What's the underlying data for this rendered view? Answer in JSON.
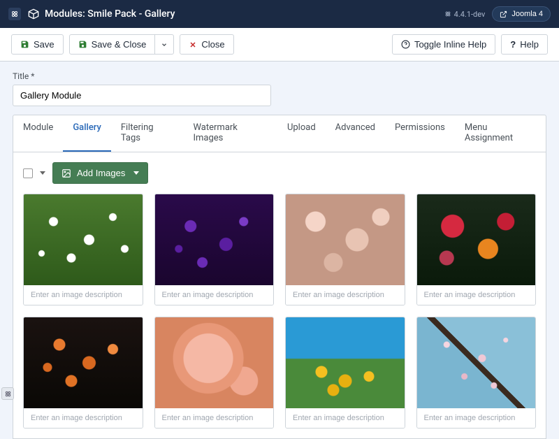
{
  "header": {
    "page_title": "Modules: Smile Pack - Gallery",
    "version": "4.4.1-dev",
    "joomla_label": "Joomla 4"
  },
  "toolbar": {
    "save": "Save",
    "save_close": "Save & Close",
    "close": "Close",
    "toggle_help": "Toggle Inline Help",
    "help": "Help"
  },
  "form": {
    "title_label": "Title *",
    "title_value": "Gallery Module"
  },
  "tabs": [
    {
      "label": "Module",
      "active": false
    },
    {
      "label": "Gallery",
      "active": true
    },
    {
      "label": "Filtering Tags",
      "active": false
    },
    {
      "label": "Watermark Images",
      "active": false
    },
    {
      "label": "Upload",
      "active": false
    },
    {
      "label": "Advanced",
      "active": false
    },
    {
      "label": "Permissions",
      "active": false
    },
    {
      "label": "Menu Assignment",
      "active": false
    }
  ],
  "gallery": {
    "add_images": "Add Images",
    "desc_placeholder": "Enter an image description",
    "items": [
      {
        "desc": ""
      },
      {
        "desc": ""
      },
      {
        "desc": ""
      },
      {
        "desc": ""
      },
      {
        "desc": ""
      },
      {
        "desc": ""
      },
      {
        "desc": ""
      },
      {
        "desc": ""
      }
    ]
  }
}
